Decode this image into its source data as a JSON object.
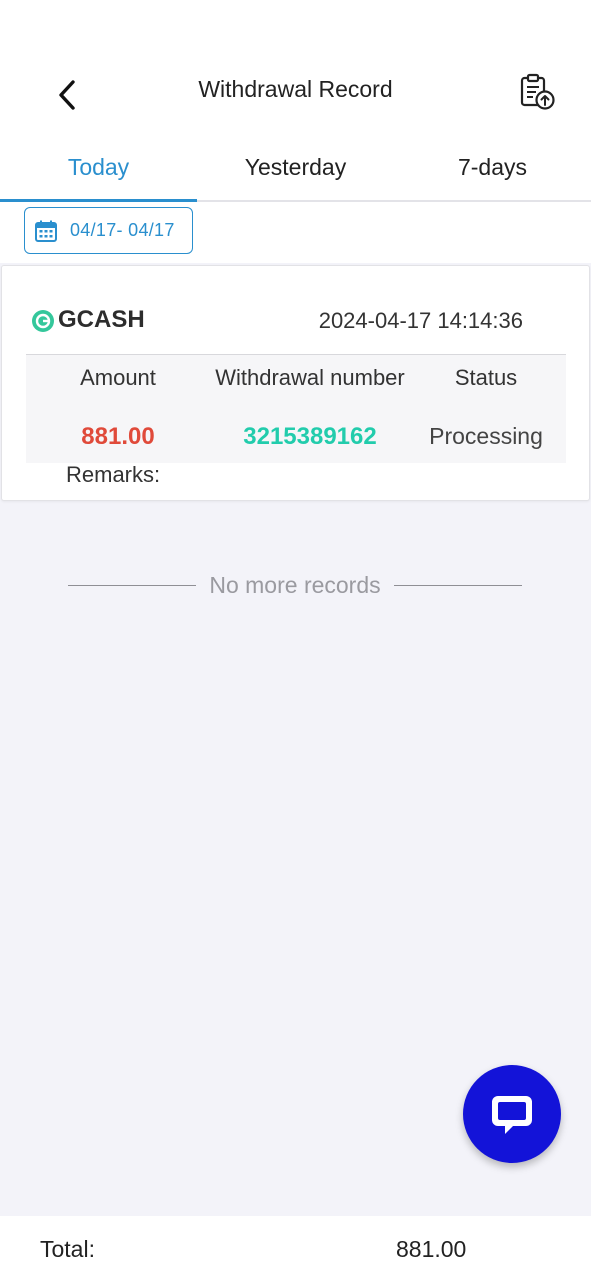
{
  "header": {
    "title": "Withdrawal Record",
    "back_icon": "chevron-left-icon",
    "action_icon": "clipboard-upload-icon"
  },
  "tabs": [
    {
      "label": "Today",
      "active": true
    },
    {
      "label": "Yesterday",
      "active": false
    },
    {
      "label": "7-days",
      "active": false
    }
  ],
  "date_range": {
    "label": "04/17- 04/17",
    "icon": "calendar-icon"
  },
  "record": {
    "method": "GCASH",
    "method_icon": "gcash-logo-icon",
    "time": "2024-04-17 14:14:36",
    "columns": {
      "amount": "Amount",
      "number": "Withdrawal number",
      "status": "Status"
    },
    "amount": "881.00",
    "number": "3215389162",
    "status": "Processing",
    "remarks_label": "Remarks:"
  },
  "no_more": "No more records",
  "fab_icon": "chat-icon",
  "footer": {
    "total_label": "Total:",
    "total_value": "881.00"
  },
  "colors": {
    "accent": "#2a8fce",
    "amount": "#e04a3a",
    "number": "#22ccac",
    "fab": "#1313d8",
    "gcash": "#34c79b"
  }
}
